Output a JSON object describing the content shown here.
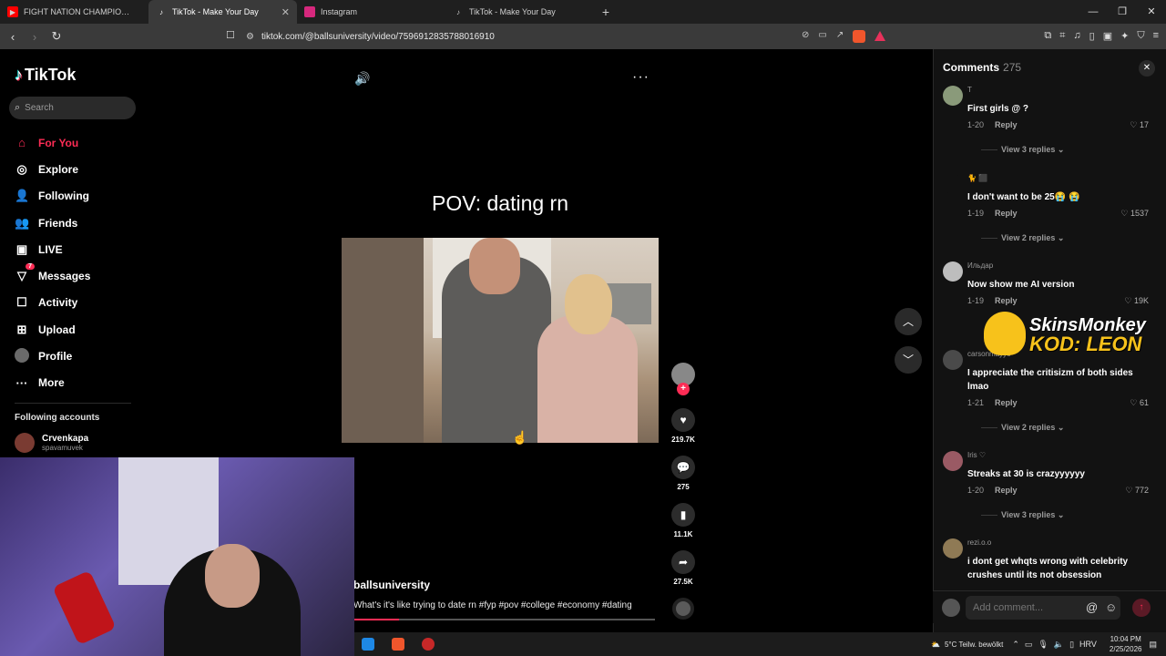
{
  "browser": {
    "tabs": [
      {
        "label": "FIGHT NATION CHAMPIONSHIP - FN",
        "active": false
      },
      {
        "label": "TikTok - Make Your Day",
        "active": true
      },
      {
        "label": "Instagram",
        "active": false
      },
      {
        "label": "TikTok - Make Your Day",
        "active": false
      }
    ],
    "url": "tiktok.com/@ballsuniversity/video/7596912835788016910"
  },
  "sidebar": {
    "logo": "TikTok",
    "search_placeholder": "Search",
    "nav": [
      {
        "label": "For You",
        "icon": "home-icon",
        "active": true
      },
      {
        "label": "Explore",
        "icon": "compass-icon"
      },
      {
        "label": "Following",
        "icon": "following-icon"
      },
      {
        "label": "Friends",
        "icon": "friends-icon"
      },
      {
        "label": "LIVE",
        "icon": "live-icon"
      },
      {
        "label": "Messages",
        "icon": "messages-icon",
        "badge": "7"
      },
      {
        "label": "Activity",
        "icon": "activity-icon"
      },
      {
        "label": "Upload",
        "icon": "upload-icon"
      },
      {
        "label": "Profile",
        "icon": "profile-avatar"
      },
      {
        "label": "More",
        "icon": "more-icon"
      }
    ],
    "following_title": "Following accounts",
    "following": [
      {
        "name": "Crvenkapa",
        "handle": "spavamuvek"
      }
    ]
  },
  "video": {
    "overlay_text": "POV: dating rn",
    "author": "ballsuniversity",
    "caption": "What's it's like trying to date rn #fyp #pov #college #economy #dating",
    "progress": 0.15,
    "likes": "219.7K",
    "comments": "275",
    "saves": "11.1K",
    "shares": "27.5K"
  },
  "comments_panel": {
    "title": "Comments",
    "count": "275",
    "items": [
      {
        "user": "T",
        "text": "First girls @ ?",
        "date": "1-20",
        "reply": "Reply",
        "likes": "17",
        "view_replies": "View 3 replies"
      },
      {
        "user": "🐈 ⬛",
        "text": "I don't want to be 25😭 😭",
        "date": "1-19",
        "reply": "Reply",
        "likes": "1537",
        "view_replies": "View 2 replies"
      },
      {
        "user": "Ильдар",
        "text": "Now show me AI version",
        "date": "1-19",
        "reply": "Reply",
        "likes": "19K",
        "view_replies": ""
      },
      {
        "user": "carsonmayyo",
        "text": "I appreciate the critisizm of both sides lmao",
        "date": "1-21",
        "reply": "Reply",
        "likes": "61",
        "view_replies": "View 2 replies"
      },
      {
        "user": "Iris ♡",
        "text": "Streaks at 30 is crazyyyyyy",
        "date": "1-20",
        "reply": "Reply",
        "likes": "772",
        "view_replies": "View 3 replies"
      },
      {
        "user": "rezi.o.o",
        "text": "i dont get whqts wrong with celebrity crushes until its not obsession",
        "date": "",
        "reply": "",
        "likes": "",
        "view_replies": ""
      }
    ],
    "add_placeholder": "Add comment..."
  },
  "sponsor": {
    "line1": "SkinsMonkey",
    "line2": "KOD: LEON"
  },
  "taskbar": {
    "weather": "5°C  Teilw. bewölkt",
    "lang": "HRV",
    "time": "10:04 PM",
    "date": "2/25/2026"
  },
  "colors": {
    "accent": "#fe2c55",
    "panel": "#121212",
    "chrome": "#3a3a3a"
  }
}
